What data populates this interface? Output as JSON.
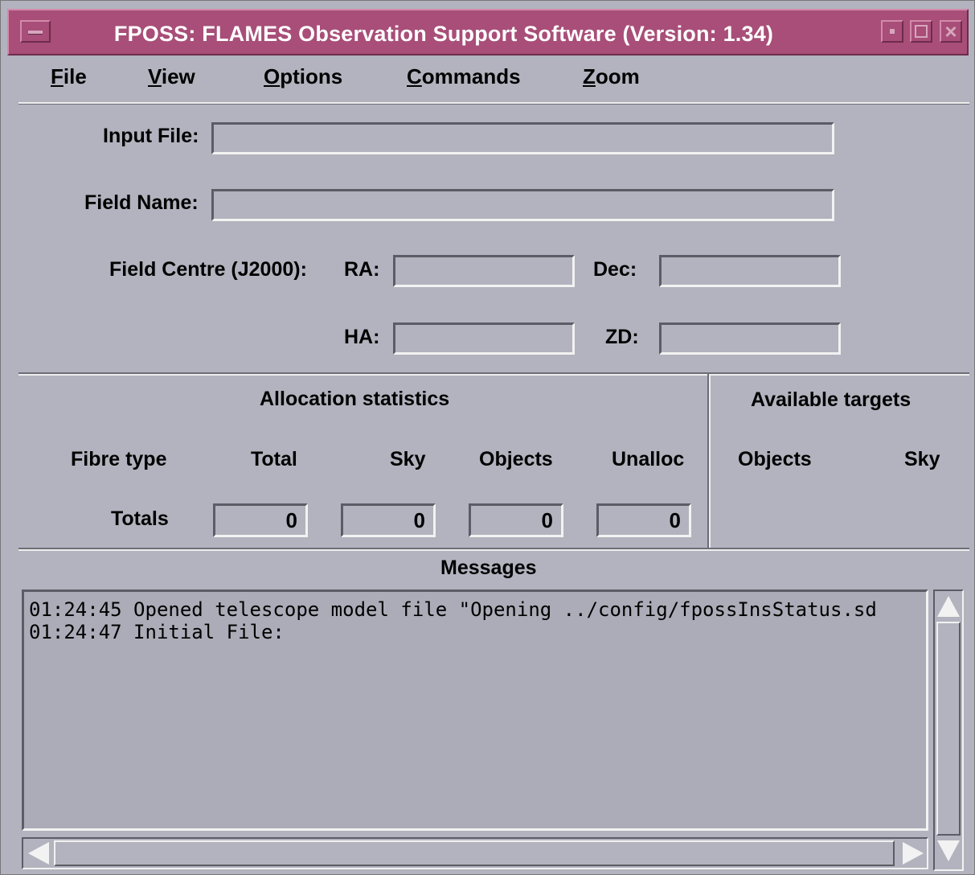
{
  "window": {
    "title": "FPOSS: FLAMES Observation Support Software (Version: 1.34)"
  },
  "menu": [
    {
      "label": "File",
      "mnemonic": "F",
      "rest": "ile"
    },
    {
      "label": "View",
      "mnemonic": "V",
      "rest": "iew"
    },
    {
      "label": "Options",
      "mnemonic": "O",
      "rest": "ptions"
    },
    {
      "label": "Commands",
      "mnemonic": "C",
      "rest": "ommands"
    },
    {
      "label": "Zoom",
      "mnemonic": "Z",
      "rest": "oom"
    }
  ],
  "form": {
    "input_file_label": "Input File:",
    "input_file_value": "",
    "field_name_label": "Field Name:",
    "field_name_value": "",
    "field_centre_label": "Field Centre (J2000):",
    "ra_label": "RA:",
    "ra_value": "",
    "dec_label": "Dec:",
    "dec_value": "",
    "ha_label": "HA:",
    "ha_value": "",
    "zd_label": "ZD:",
    "zd_value": ""
  },
  "allocation": {
    "title": "Allocation statistics",
    "headers": [
      "Fibre type",
      "Total",
      "Sky",
      "Objects",
      "Unalloc"
    ],
    "totals_label": "Totals",
    "totals": [
      "0",
      "0",
      "0",
      "0"
    ]
  },
  "available": {
    "title": "Available targets",
    "headers": [
      "Objects",
      "Sky"
    ]
  },
  "messages": {
    "title": "Messages",
    "lines": [
      "01:24:45 Opened telescope model file \"Opening ../config/fpossInsStatus.sd",
      "01:24:47 Initial File:"
    ]
  }
}
